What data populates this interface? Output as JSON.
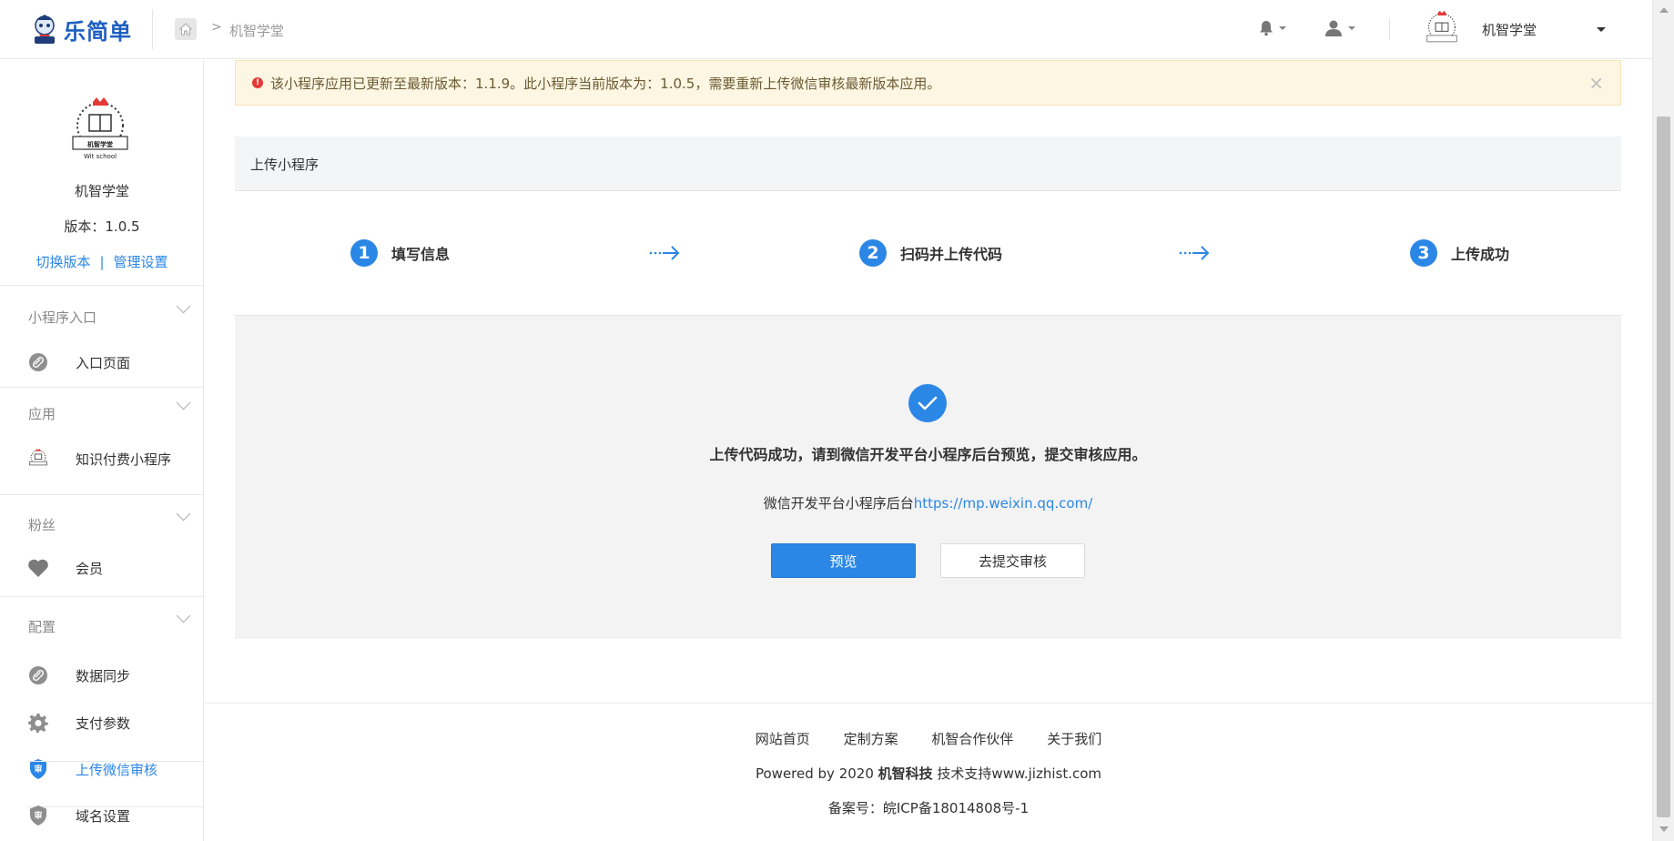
{
  "header": {
    "logo_text": "乐简单",
    "breadcrumb_current": "机智学堂",
    "breadcrumb_sep": ">",
    "account_name": "机智学堂"
  },
  "emblem": {
    "caption": "机智学堂",
    "subcaption": "Wit school"
  },
  "sidebar": {
    "app_name": "机智学堂",
    "version": "版本：1.0.5",
    "switch_version": "切换版本",
    "link_sep": "|",
    "manage_settings": "管理设置",
    "groups": [
      {
        "title": "小程序入口",
        "items": [
          {
            "label": "入口页面",
            "icon": "link-icon"
          }
        ]
      },
      {
        "title": "应用",
        "items": [
          {
            "label": "知识付费小程序",
            "icon": "app-emblem-icon"
          }
        ]
      },
      {
        "title": "粉丝",
        "items": [
          {
            "label": "会员",
            "icon": "heart-icon"
          }
        ]
      },
      {
        "title": "配置",
        "items": [
          {
            "label": "数据同步",
            "icon": "link-icon"
          },
          {
            "label": "支付参数",
            "icon": "gear-icon"
          },
          {
            "label": "上传微信审核",
            "icon": "shield-icon",
            "active": true
          },
          {
            "label": "域名设置",
            "icon": "shield-icon"
          }
        ]
      }
    ]
  },
  "notice": {
    "icon_glyph": "!",
    "text": "该小程序应用已更新至最新版本：1.1.9。此小程序当前版本为：1.0.5，需要重新上传微信审核最新版本应用。",
    "close": "×"
  },
  "panel": {
    "title": "上传小程序",
    "steps": [
      {
        "num": "1",
        "label": "填写信息"
      },
      {
        "num": "2",
        "label": "扫码并上传代码"
      },
      {
        "num": "3",
        "label": "上传成功"
      }
    ]
  },
  "result": {
    "title": "上传代码成功，请到微信开发平台小程序后台预览，提交审核应用。",
    "link_prefix": "微信开发平台小程序后台",
    "link_url": "https://mp.weixin.qq.com/",
    "preview_button": "预览",
    "submit_button": "去提交审核"
  },
  "footer": {
    "links": [
      "网站首页",
      "定制方案",
      "机智合作伙伴",
      "关于我们"
    ],
    "powered_prefix": "Powered by 2020 ",
    "powered_company": "机智科技",
    "powered_suffix": " 技术支持www.jizhist.com",
    "icp": "备案号：皖ICP备18014808号-1"
  },
  "colors": {
    "primary": "#2b87e6",
    "notice_bg": "#fdf6e3",
    "panel_bg": "#f3f3f3"
  }
}
